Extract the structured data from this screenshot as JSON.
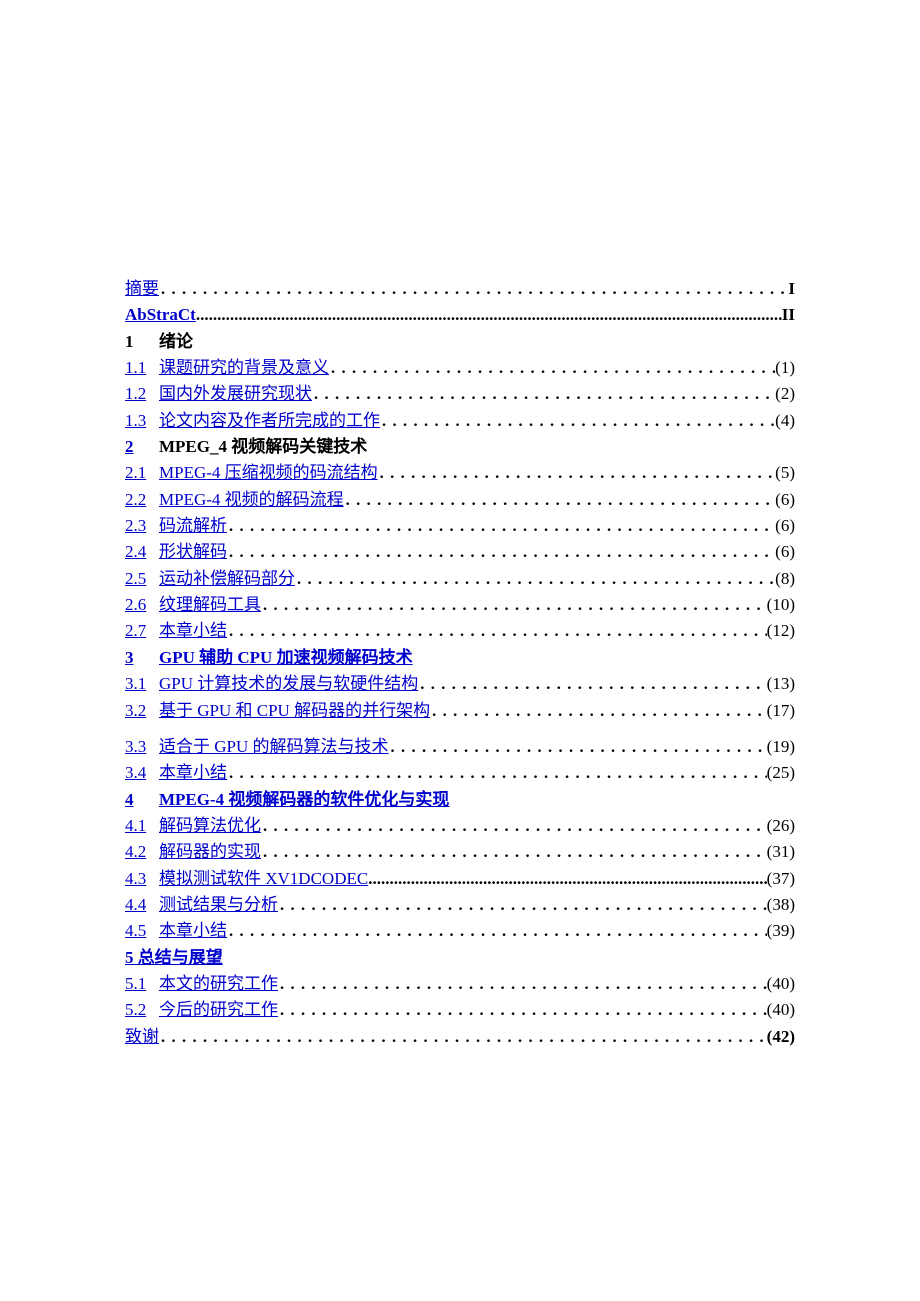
{
  "top": [
    {
      "label": "摘要",
      "page": "I",
      "labelLink": true,
      "boldPage": true
    },
    {
      "label": "AbStraCt",
      "page": "II",
      "labelLink": true,
      "boldLabel": true,
      "boldPage": true,
      "boldDots": true
    }
  ],
  "chapters": [
    {
      "num": "1",
      "title": "绪论",
      "numLink": false,
      "titleLink": false,
      "items": [
        {
          "num": "1.1",
          "label": "课题研究的背景及意义",
          "page": "(1)"
        },
        {
          "num": "1.2",
          "label": "国内外发展研究现状",
          "page": "(2)"
        },
        {
          "num": "1.3",
          "label": "论文内容及作者所完成的工作",
          "page": "(4)"
        }
      ]
    },
    {
      "num": "2",
      "title": "MPEG_4 视频解码关键技术",
      "numLink": true,
      "titleLink": false,
      "items": [
        {
          "num": "2.1",
          "label": "MPEG-4 压缩视频的码流结构",
          "page": "(5)"
        },
        {
          "num": "2.2",
          "label": "MPEG-4 视频的解码流程",
          "page": "(6)"
        },
        {
          "num": "2.3",
          "label": "码流解析",
          "page": "(6)"
        },
        {
          "num": "2.4",
          "label": "形状解码",
          "page": "(6)"
        },
        {
          "num": "2.5",
          "label": "运动补偿解码部分",
          "page": "(8)"
        },
        {
          "num": "2.6",
          "label": "纹理解码工具",
          "page": "(10)"
        },
        {
          "num": "2.7",
          "label": "本章小结",
          "page": "(12)"
        }
      ]
    },
    {
      "num": "3",
      "title": "GPU 辅助 CPU 加速视频解码技术",
      "numLink": true,
      "titleLink": true,
      "items": [
        {
          "num": "3.1",
          "label": "GPU 计算技术的发展与软硬件结构",
          "page": "(13)"
        },
        {
          "num": "3.2",
          "label": "基于 GPU 和 CPU 解码器的并行架构",
          "page": "(17)",
          "gapAfter": true
        },
        {
          "num": "3.3",
          "label": "适合于 GPU 的解码算法与技术",
          "page": "(19)"
        },
        {
          "num": "3.4",
          "label": "本章小结",
          "page": "(25)"
        }
      ]
    },
    {
      "num": "4",
      "title": "MPEG-4 视频解码器的软件优化与实现",
      "numLink": true,
      "titleLink": true,
      "items": [
        {
          "num": "4.1",
          "label": "解码算法优化",
          "page": "(26)"
        },
        {
          "num": "4.2",
          "label": "解码器的实现",
          "page": "(31)"
        },
        {
          "num": "4.3",
          "label": "模拟测试软件 XV1DCODEC",
          "page": "(37)",
          "boldDots": true
        },
        {
          "num": "4.4",
          "label": "测试结果与分析",
          "page": "(38)"
        },
        {
          "num": "4.5",
          "label": "本章小结",
          "page": "(39)"
        }
      ]
    },
    {
      "num": "5",
      "title": "总结与展望",
      "numLink": true,
      "titleLink": true,
      "inline": true,
      "items": [
        {
          "num": "5.1",
          "label": "本文的研究工作",
          "page": "(40)"
        },
        {
          "num": "5.2",
          "label": "今后的研究工作",
          "page": "(40)"
        }
      ]
    }
  ],
  "bottom": [
    {
      "label": "致谢",
      "page": "(42)",
      "labelLink": true,
      "boldPage": true
    }
  ]
}
